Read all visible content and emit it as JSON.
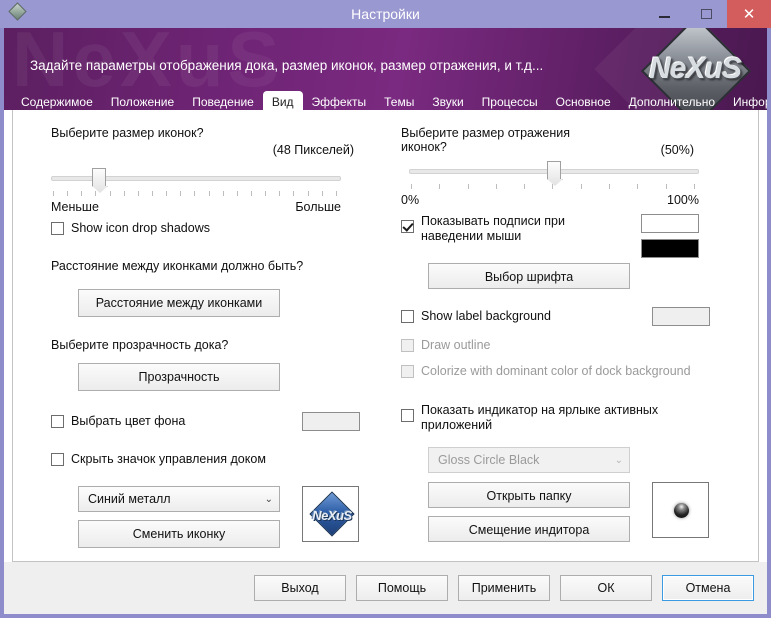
{
  "window": {
    "title": "Настройки",
    "app_icon": "diamond-icon",
    "controls": {
      "minimize": "minimize-icon",
      "maximize": "maximize-icon",
      "close": "✕"
    }
  },
  "banner": {
    "description": "Задайте параметры отображения дока, размер иконок, размер отражения, и т.д...",
    "logo_text": "NeXuS",
    "watermark_text": "NeXuS",
    "bg_color": "#6e2474"
  },
  "tabs": {
    "active_index": 3,
    "items": [
      {
        "label": "Содержимое"
      },
      {
        "label": "Положение"
      },
      {
        "label": "Поведение"
      },
      {
        "label": "Вид"
      },
      {
        "label": "Эффекты"
      },
      {
        "label": "Темы"
      },
      {
        "label": "Звуки"
      },
      {
        "label": "Процессы"
      },
      {
        "label": "Основное"
      },
      {
        "label": "Дополнительно"
      },
      {
        "label": "Информация"
      }
    ]
  },
  "left_column": {
    "icon_size_question": "Выберите размер иконок?",
    "icon_size_value": "(48 Пикселей)",
    "icon_size_slider": {
      "min_label": "Меньше",
      "max_label": "Больше",
      "position_percent": 16,
      "tick_count": 21
    },
    "show_shadows_checkbox": {
      "label": "Show icon drop shadows",
      "checked": false
    },
    "spacing_question": "Расстояние между иконками должно быть?",
    "spacing_button": "Расстояние между иконками",
    "transparency_question": "Выберите прозрачность дока?",
    "transparency_button": "Прозрачность",
    "bg_color_checkbox": {
      "label": "Выбрать цвет фона",
      "checked": false
    },
    "bg_color_swatch": "#efefef",
    "hide_dock_icon_checkbox": {
      "label": "Скрыть значок управления доком",
      "checked": false
    },
    "icon_theme_combo": {
      "value": "Синий металл",
      "chevron": "⌄"
    },
    "change_icon_button": "Сменить иконку",
    "icon_preview": "nexus-blue-metal-icon"
  },
  "right_column": {
    "reflection_question_line1": "Выберите размер отражения",
    "reflection_question_line2": "иконок?",
    "reflection_value": "(50%)",
    "reflection_slider": {
      "min_label": "0%",
      "max_label": "100%",
      "position_percent": 50,
      "tick_count": 11
    },
    "show_labels_checkbox": {
      "label": "Показывать подписи при наведении мыши",
      "checked": true
    },
    "label_color_swatch": "#ffffff",
    "font_color_swatch": "#000000",
    "font_button": "Выбор шрифта",
    "label_bg_checkbox": {
      "label": "Show label background",
      "checked": false,
      "disabled": false
    },
    "label_bg_swatch": "#efefef",
    "draw_outline_checkbox": {
      "label": "Draw outline",
      "checked": false,
      "disabled": true
    },
    "colorize_checkbox": {
      "label": "Colorize with dominant color of dock background",
      "checked": false,
      "disabled": true
    },
    "indicator_checkbox": {
      "label": "Показать индикатор на ярлыке активных приложений",
      "checked": false
    },
    "indicator_combo": {
      "value": "Gloss Circle Black",
      "chevron": "⌄",
      "disabled": true
    },
    "open_folder_button": "Открыть папку",
    "indicator_offset_button": "Смещение индитора",
    "indicator_preview": "gloss-circle-black-icon"
  },
  "footer": {
    "buttons": [
      {
        "label": "Выход",
        "default": false
      },
      {
        "label": "Помощь",
        "default": false
      },
      {
        "label": "Применить",
        "default": false
      },
      {
        "label": "ОК",
        "default": false
      },
      {
        "label": "Отмена",
        "default": true
      }
    ]
  }
}
